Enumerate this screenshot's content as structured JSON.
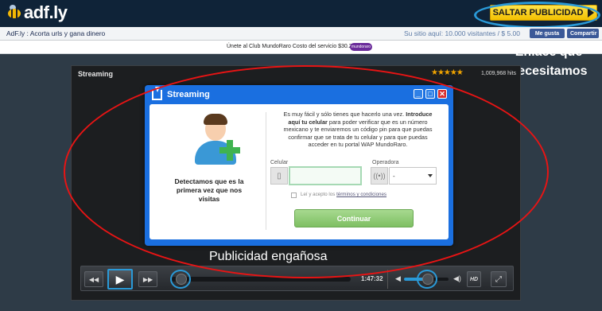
{
  "header": {
    "logo_text": "adf.ly",
    "skip_label": "SALTAR PUBLICIDAD"
  },
  "infobar": {
    "left_text": "AdF.ly : Acorta urls y gana dinero",
    "right_text": "Su sitio aquí: 10.000 visitantes / $ 5.00",
    "fb_like": "Me gusta",
    "fb_share": "Compartir"
  },
  "club": {
    "text": "Únete al Club MundoRaro Costo del servicio $30.26",
    "logo_text": "mundoraro"
  },
  "annotations": {
    "enlace_note": "Enlace que necesitamos",
    "publicidad_note": "Publicidad engañosa",
    "colors": {
      "highlight_ring": "#2a9ad8",
      "red_ellipse": "#e81414"
    }
  },
  "player": {
    "title": "Streaming",
    "rating_stars": "★★★★★",
    "rating_value": 5,
    "views": "1,009,968 hits"
  },
  "dialog": {
    "title": "Streaming",
    "detect_text": "Detectamos que es la primera vez que nos visitas",
    "desc_intro": "Es muy fácil y sólo tienes que hacerlo una vez.",
    "desc_bold": "Introduce aquí tu celular",
    "desc_rest": "para poder verificar que es un número mexicano y te enviaremos un código pin para que puedas confirmar que se trata de tu celular y para que puedas acceder en tu portal WAP MundoRaro.",
    "celular_label": "Celular",
    "celular_value": "",
    "operadora_label": "Operadora",
    "operadora_value": "-",
    "terms_prefix": "Leí y acepto los",
    "terms_link": "términos y condiciones",
    "continue_label": "Continuar",
    "window_buttons": {
      "minimize": "_",
      "maximize": "□",
      "close": "✕"
    }
  },
  "controls": {
    "time": "1:47:32",
    "hd_label": "HD",
    "icons": {
      "rewind": "rewind-icon",
      "play": "play-icon",
      "forward": "fast-forward-icon",
      "volume": "volume-icon",
      "fullscreen": "fullscreen-icon"
    },
    "volume_level": 0.5,
    "seek_position": 0.05
  }
}
